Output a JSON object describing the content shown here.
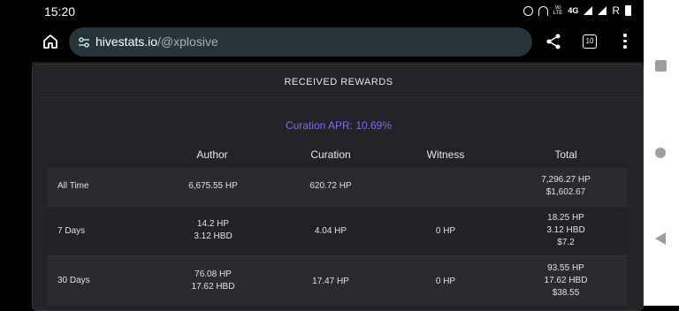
{
  "status_bar": {
    "time": "15:20",
    "network": "4G",
    "volte_line1": "Vo",
    "volte_line2": "LTE",
    "roaming": "R"
  },
  "browser": {
    "url_host": "hivestats.io",
    "url_path": "/@xplosive",
    "tab_count": "10"
  },
  "card": {
    "title": "RECEIVED REWARDS",
    "curation_apr": "Curation APR: 10.69%"
  },
  "table": {
    "columns": [
      "Author",
      "Curation",
      "Witness",
      "Total"
    ],
    "rows": [
      {
        "label": "All Time",
        "author": [
          "6,675.55 HP"
        ],
        "curation": [
          "620.72 HP"
        ],
        "witness": [],
        "total": [
          "7,296.27 HP",
          "$1,602.67"
        ]
      },
      {
        "label": "7 Days",
        "author": [
          "14.2 HP",
          "3.12 HBD"
        ],
        "curation": [
          "4.04 HP"
        ],
        "witness": [
          "0 HP"
        ],
        "total": [
          "18.25 HP",
          "3.12 HBD",
          "$7.2"
        ]
      },
      {
        "label": "30 Days",
        "author": [
          "76.08 HP",
          "17.62 HBD"
        ],
        "curation": [
          "17.47 HP"
        ],
        "witness": [
          "0 HP"
        ],
        "total": [
          "93.55 HP",
          "17.62 HBD",
          "$38.55"
        ]
      }
    ]
  },
  "colors": {
    "apr_accent": "#7b6ef5",
    "card_bg": "#232327",
    "url_bar_bg": "#26353a"
  }
}
